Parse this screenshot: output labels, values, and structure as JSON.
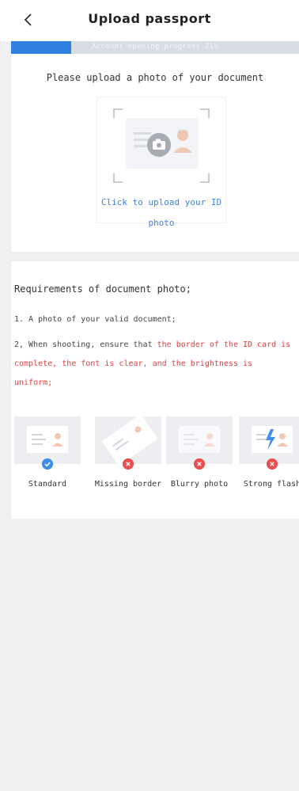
{
  "header": {
    "title": "Upload passport",
    "back_icon": "chevron-left-icon"
  },
  "progress": {
    "label": "Account opening progress 21%",
    "percent": 21,
    "fill_color": "#2f7fe0"
  },
  "upload": {
    "heading": "Please upload a photo of your document",
    "link_line1": "Click to upload your ID",
    "link_line2": "photo",
    "camera_icon": "camera-icon"
  },
  "requirements": {
    "title": "Requirements of document photo;",
    "item1": "1. A photo of your valid document;",
    "item2_prefix": "2, When shooting, ensure that ",
    "item2_highlight": "the border of the ID card is complete, the font is clear, and the brightness is uniform;",
    "highlight_color": "#e63a3a"
  },
  "samples": [
    {
      "label": "Standard",
      "status": "ok"
    },
    {
      "label": "Missing border",
      "status": "bad"
    },
    {
      "label": "Blurry photo",
      "status": "bad"
    },
    {
      "label": "Strong flash",
      "status": "bad"
    }
  ]
}
